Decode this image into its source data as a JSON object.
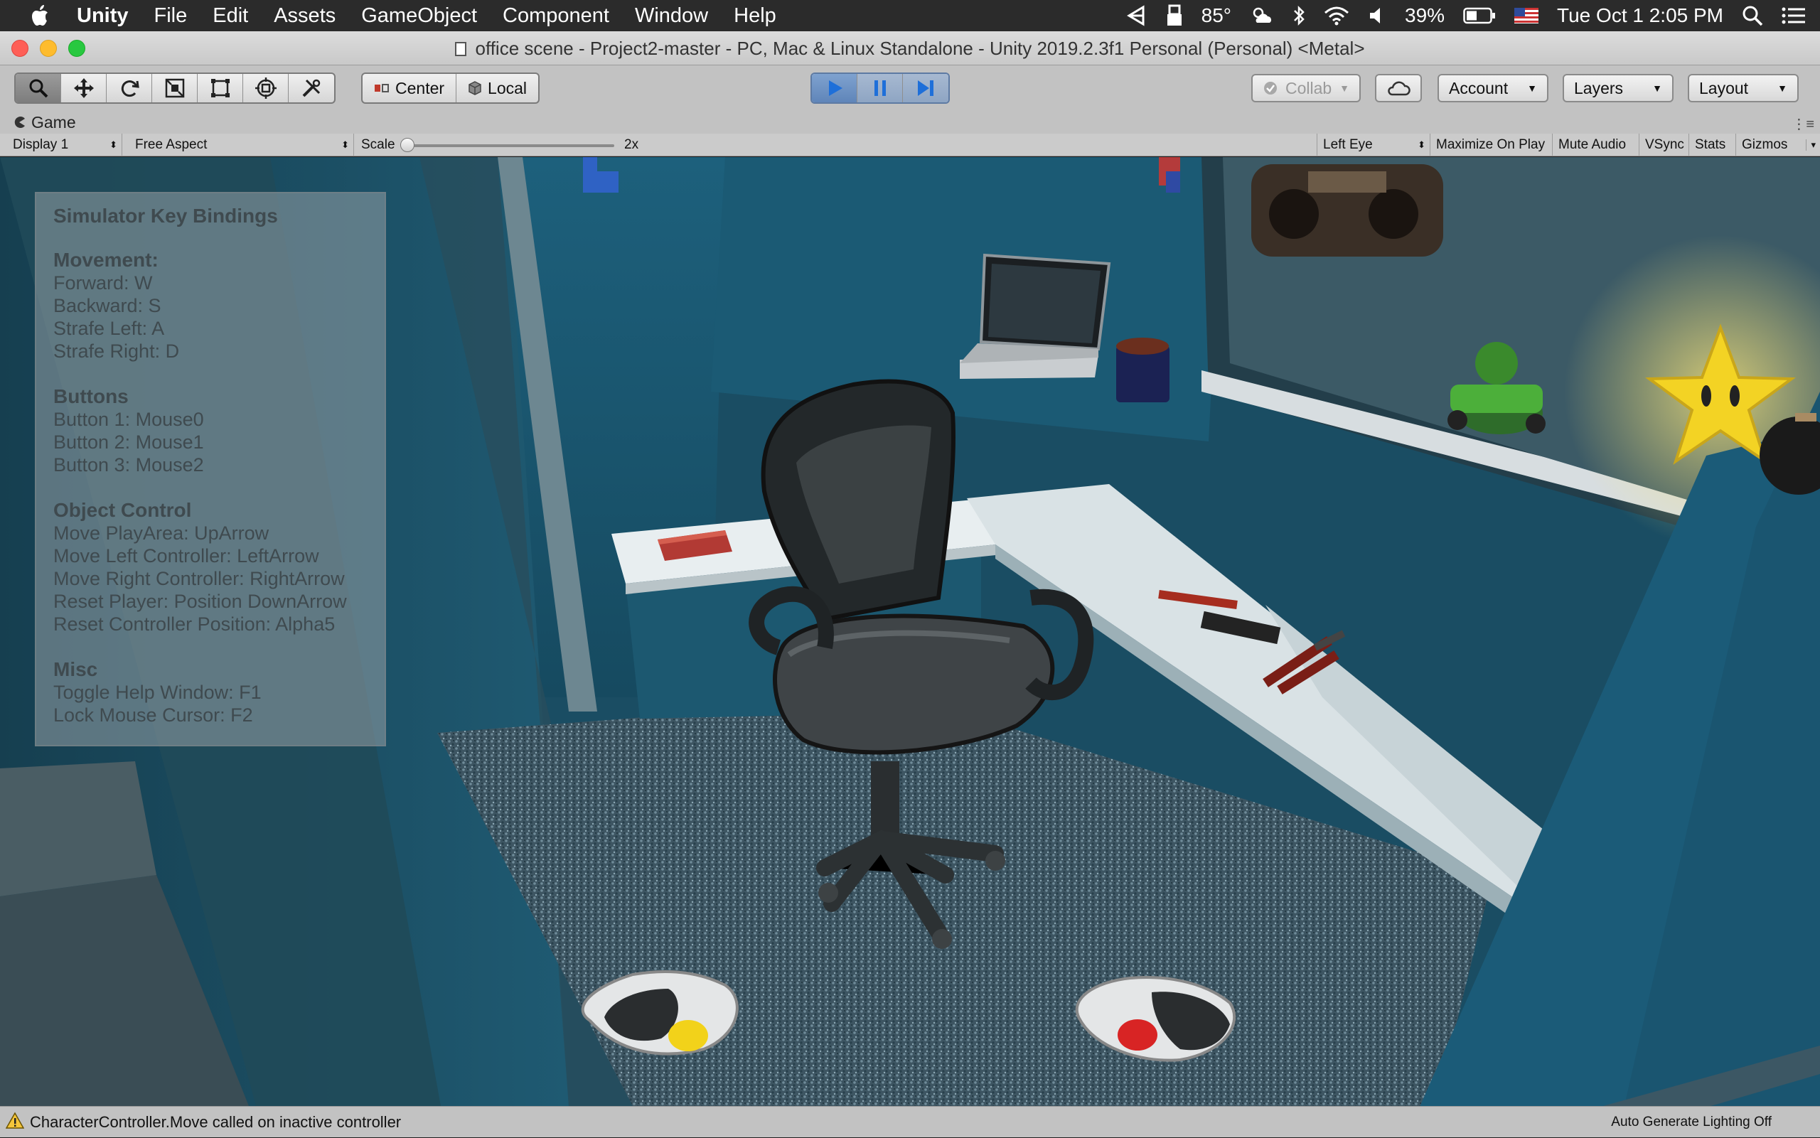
{
  "menubar": {
    "app_name": "Unity",
    "items": [
      "File",
      "Edit",
      "Assets",
      "GameObject",
      "Component",
      "Window",
      "Help"
    ],
    "temperature": "85°",
    "battery": "39%",
    "datetime": "Tue Oct 1  2:05 PM"
  },
  "window": {
    "title": "office scene - Project2-master - PC, Mac & Linux Standalone - Unity 2019.2.3f1 Personal (Personal) <Metal>"
  },
  "toolbar": {
    "pivot_center": "Center",
    "pivot_local": "Local",
    "collab": "Collab",
    "account": "Account",
    "layers": "Layers",
    "layout": "Layout"
  },
  "game_tab": {
    "label": "Game"
  },
  "game_controls": {
    "display": "Display 1",
    "aspect": "Free Aspect",
    "scale_label": "Scale",
    "scale_value": "2x",
    "eye": "Left Eye",
    "maximize": "Maximize On Play",
    "mute": "Mute Audio",
    "vsync": "VSync",
    "stats": "Stats",
    "gizmos": "Gizmos"
  },
  "help_overlay": {
    "title": "Simulator Key Bindings",
    "movement_heading": "Movement:",
    "movement": [
      "Forward: W",
      "Backward: S",
      "Strafe Left: A",
      "Strafe Right: D"
    ],
    "buttons_heading": "Buttons",
    "buttons": [
      "Button 1: Mouse0",
      "Button 2: Mouse1",
      "Button 3: Mouse2"
    ],
    "object_heading": "Object Control",
    "object": [
      "Move PlayArea: UpArrow",
      "Move Left Controller: LeftArrow",
      "Move Right Controller: RightArrow",
      "Reset Player: Position DownArrow",
      "Reset Controller Position: Alpha5"
    ],
    "misc_heading": "Misc",
    "misc": [
      "Toggle Help Window: F1",
      "Lock Mouse Cursor: F2"
    ]
  },
  "status": {
    "message": "CharacterController.Move called on inactive controller",
    "lighting": "Auto Generate Lighting Off"
  },
  "colors": {
    "traffic_red": "#fe5f57",
    "traffic_yellow": "#febc2e",
    "traffic_green": "#28c840",
    "play_blue": "#1e6fd9",
    "wall_teal": "#1c5f7a",
    "carpet": "#3f5866"
  }
}
